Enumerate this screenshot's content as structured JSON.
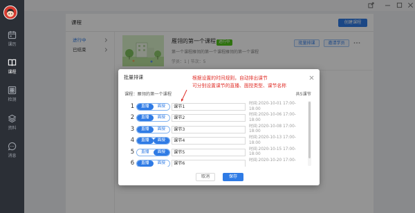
{
  "window": {
    "controls": [
      "share-icon",
      "minimize-icon",
      "maximize-icon",
      "close-icon"
    ]
  },
  "colors": {
    "primary": "#2f7be5",
    "badge": "#52c41a",
    "annotation": "#e0302a",
    "sidebar": "#2b2f36"
  },
  "sidebar": {
    "avatar_icon": "avatar",
    "items": [
      {
        "label": "课历",
        "icon": "calendar-icon",
        "active": false
      },
      {
        "label": "课程",
        "icon": "book-icon",
        "active": true
      },
      {
        "label": "检测",
        "icon": "monitor-icon",
        "active": false
      },
      {
        "label": "资料",
        "icon": "layers-icon",
        "active": false
      },
      {
        "label": "消息",
        "icon": "chat-icon",
        "active": false
      }
    ]
  },
  "header": {
    "title": "课程",
    "create_button": "创建课程"
  },
  "subnav": {
    "items": [
      {
        "label": "进行中",
        "active": true
      },
      {
        "label": "已结束",
        "active": false
      }
    ]
  },
  "course": {
    "title": "雁翎的第一个课程",
    "status_badge": "进行中",
    "description": "第一个课程雁翎的第一个课程雁翎的第一个课程",
    "meta": "学员：1 | 节次：5",
    "batch_button": "批量排课",
    "invite_button": "邀请学员",
    "more_icon": "more-icon"
  },
  "dialog": {
    "title": "批量排课",
    "annotation_line1": "根据设置的时间规则，自动排出课节",
    "annotation_line2": "可分别设置课节的直播、面授类型、课节名称",
    "course_label": "课程：雁翎的第一个课程",
    "count_label": "共5课节",
    "live_label": "直播",
    "offline_label": "面授",
    "sessions": [
      {
        "number": "1",
        "name": "课节1",
        "time_line1": "时间:2020-10-01 17:00-",
        "time_line2": "18:00",
        "live": true,
        "offline": false
      },
      {
        "number": "2",
        "name": "课节2",
        "time_line1": "时间:2020-10-06 17:00-",
        "time_line2": "18:00",
        "live": true,
        "offline": false
      },
      {
        "number": "3",
        "name": "课节3",
        "time_line1": "时间:2020-10-08 17:00-",
        "time_line2": "18:00",
        "live": true,
        "offline": false
      },
      {
        "number": "4",
        "name": "课节4",
        "time_line1": "时间:2020-10-13 17:00-",
        "time_line2": "18:00",
        "live": true,
        "offline": true
      },
      {
        "number": "5",
        "name": "课节5",
        "time_line1": "时间:2020-10-15 17:00-",
        "time_line2": "18:00",
        "live": false,
        "offline": true
      },
      {
        "number": "6",
        "name": "课节6",
        "time_line1": "时间:2020-10-20 17:00-",
        "live": true,
        "offline": false
      }
    ],
    "cancel_button": "取消",
    "save_button": "保存"
  }
}
